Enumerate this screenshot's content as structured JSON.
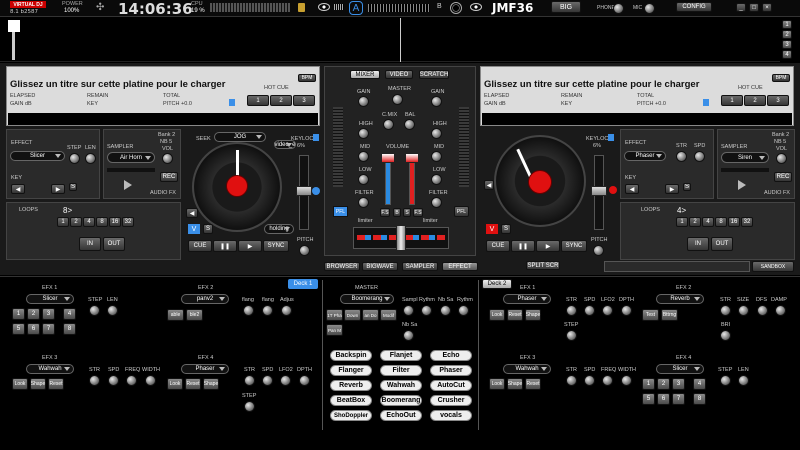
{
  "top": {
    "brand": "VIRTUAL DJ",
    "version": "8.1 b2587",
    "power_label": "POWER",
    "power_value": "100%",
    "clock": "14:06:36",
    "cpu_label": "CPU",
    "cpu_value": "19 %",
    "badge_a": "A",
    "letter_b": "B",
    "deck_name": "JMF36",
    "big_label": "BIG",
    "phone_label": "PHONE",
    "mic_label": "MIC",
    "config_label": "CONFIG",
    "rhs": [
      "1",
      "2",
      "3",
      "4"
    ]
  },
  "deck_left": {
    "title": "Glissez un titre sur cette platine pour le charger",
    "bpm_badge": "BPM",
    "elapsed": "ELAPSED",
    "remain": "REMAIN",
    "total": "TOTAL",
    "gain": "GAIN dB",
    "key": "KEY",
    "pitch": "PITCH +0.0",
    "hotcue": "HOT CUE",
    "hotcues": [
      "1",
      "2",
      "3"
    ],
    "effect_label": "EFFECT",
    "effect_value": "Slicer",
    "step": "STEP",
    "len": "LEN",
    "sampler_label": "SAMPLER",
    "sampler_value": "Air Horn",
    "bank": "Bank 2",
    "nb": "NB 5",
    "vol": "VOL",
    "rec": "REC",
    "audiofx": "AUDIO FX",
    "key_label": "KEY",
    "seek": "SEEK",
    "jog_value": "JOG",
    "keylock": "KEYLOCK",
    "keylock_val": "6%",
    "video_label": "video_e",
    "holding": "holding",
    "pitch_label": "PITCH",
    "loops_label": "LOOPS",
    "loops_value": "8>",
    "loop_sizes": [
      "1",
      "2",
      "4",
      "8",
      "16",
      "32"
    ],
    "in": "IN",
    "out": "OUT",
    "cue": "CUE",
    "pause": "❚❚",
    "play": "▶",
    "sync": "SYNC",
    "v": "V",
    "s": "S",
    "pfl": "PFL"
  },
  "deck_right": {
    "title": "Glissez un titre sur cette platine pour le charger",
    "bpm_badge": "BPM",
    "elapsed": "ELAPSED",
    "remain": "REMAIN",
    "total": "TOTAL",
    "gain": "GAIN dB",
    "key": "KEY",
    "pitch": "PITCH +0.0",
    "hotcue": "HOT CUE",
    "hotcues": [
      "1",
      "2",
      "3"
    ],
    "effect_label": "EFFECT",
    "effect_value": "Phaser",
    "str": "STR",
    "spd": "SPD",
    "sampler_label": "SAMPLER",
    "sampler_value": "Siren",
    "bank": "Bank 2",
    "nb": "NB 5",
    "vol": "VOL",
    "rec": "REC",
    "audiofx": "AUDIO FX",
    "key_label": "KEY",
    "keylock": "KEYLOCK",
    "keylock_val": "6%",
    "pitch_label": "PITCH",
    "loops_label": "LOOPS",
    "loops_value": "4>",
    "loop_sizes": [
      "1",
      "2",
      "4",
      "8",
      "16",
      "32"
    ],
    "in": "IN",
    "out": "OUT",
    "cue": "CUE",
    "pause": "❚❚",
    "play": "▶",
    "sync": "SYNC",
    "v": "V",
    "s": "S",
    "pfl": "PFL"
  },
  "mixer": {
    "tabs": [
      "MIXER",
      "VIDEO",
      "SCRATCH"
    ],
    "gain": "GAIN",
    "master": "MASTER",
    "high": "HIGH",
    "cmix": "C.MIX",
    "bal": "BAL",
    "mid": "MID",
    "volume": "VOLUME",
    "low": "LOW",
    "filter": "FILTER",
    "limiter": "limiter",
    "pfl": "PFL",
    "fs": [
      "F.S",
      "B",
      "S",
      "F.S"
    ]
  },
  "bottom_tabs": [
    "BROWSER",
    "BIGWAVE",
    "SAMPLER",
    "EFFECT"
  ],
  "split": "SPLIT SCR",
  "sandbox": "SANDBOX",
  "fx_left": {
    "deck_tag": "Deck 1",
    "efx1": "EFX 1",
    "efx1_value": "Slicer",
    "efx1_knobs": [
      "STEP",
      "LEN"
    ],
    "efx1_buttons": [
      "1",
      "2",
      "3",
      "4",
      "5",
      "6",
      "7",
      "8"
    ],
    "efx2": "EFX 2",
    "efx2_value": "panv2",
    "efx2_knobs": [
      "flang",
      "flang",
      "Adjus"
    ],
    "efx2_buttons": [
      "able",
      "ble2"
    ],
    "efx3": "EFX 3",
    "efx3_value": "Wahwah",
    "efx3_knobs": [
      "STR",
      "SPD",
      "FREQ",
      "WIDTH"
    ],
    "efx3_buttons": [
      "Look",
      "Shape",
      "Reset"
    ],
    "efx4": "EFX 4",
    "efx4_value": "Phaser",
    "efx4_knobs": [
      "STR",
      "SPD",
      "LFO2",
      "DPTH"
    ],
    "efx4_buttons": [
      "Look",
      "Reset",
      "Shape"
    ],
    "efx4_extra": "STEP"
  },
  "fx_master": {
    "title": "MASTER",
    "value": "Boomerang",
    "knobs": [
      "Sampl",
      "Rythm",
      "Nb Sa",
      "Rythm"
    ],
    "knob2": "Nb Sa",
    "buttons": [
      "1T Pha",
      "Down",
      "an Do",
      "Modif",
      "Pan M"
    ],
    "fx_grid": [
      "Backspin",
      "Flanjet",
      "Echo",
      "Flanger",
      "Filter",
      "Phaser",
      "Reverb",
      "Wahwah",
      "AutoCut",
      "BeatBox",
      "Boomerang",
      "Crusher",
      "ShoDoppler",
      "EchoOut",
      "vocals"
    ]
  },
  "fx_right": {
    "deck_tag": "Deck 2",
    "efx1": "EFX 1",
    "efx1_value": "Phaser",
    "efx1_knobs": [
      "STR",
      "SPD",
      "LFO2",
      "DPTH"
    ],
    "efx1_buttons": [
      "Look",
      "Reset",
      "Shape"
    ],
    "efx1_extra": "STEP",
    "efx2": "EFX 2",
    "efx2_value": "Reverb",
    "efx2_knobs": [
      "STR",
      "SIZE",
      "DFS",
      "DAMP"
    ],
    "efx2_buttons": [
      "Test",
      "Bttrng"
    ],
    "efx2_extra": "BRI",
    "efx3": "EFX 3",
    "efx3_value": "Wahwah",
    "efx3_knobs": [
      "STR",
      "SPD",
      "FREQ",
      "WIDTH"
    ],
    "efx3_buttons": [
      "Look",
      "Shape",
      "Reset"
    ],
    "efx4": "EFX 4",
    "efx4_value": "Slicer",
    "efx4_knobs": [
      "STEP",
      "LEN"
    ],
    "efx4_buttons": [
      "1",
      "2",
      "3",
      "4",
      "5",
      "6",
      "7",
      "8"
    ]
  },
  "colors": {
    "accent": "#3a8fe8",
    "jog_center": "#e01010",
    "vu_red": "#e02020",
    "vu_blue": "#2a8ae0"
  }
}
